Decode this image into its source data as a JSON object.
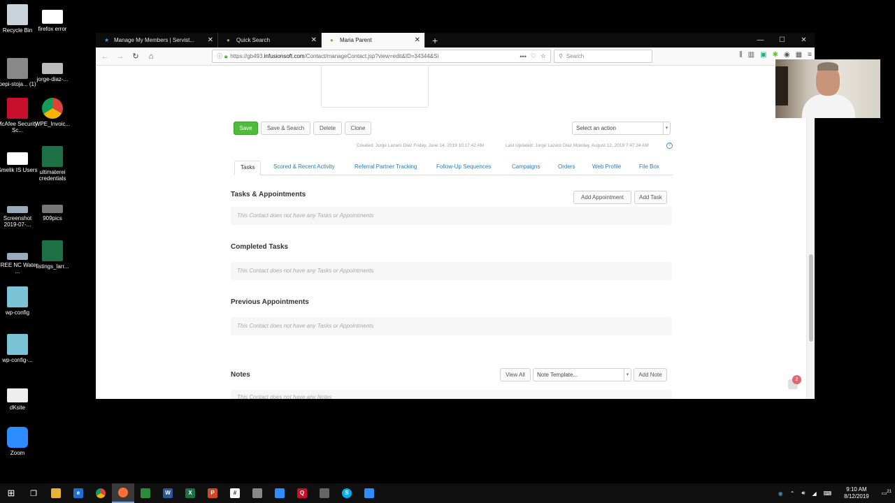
{
  "desktop": {
    "icons": [
      {
        "label": "Recycle Bin"
      },
      {
        "label": "firefox error"
      },
      {
        "label": "pepi-stoja... (1)"
      },
      {
        "label": "jorge-diaz-..."
      },
      {
        "label": "McAfee Security Sc..."
      },
      {
        "label": "WPE_Invoic..."
      },
      {
        "label": "Smelik IS Users"
      },
      {
        "label": "ultimaterei credentials"
      },
      {
        "label": "Screenshot 2019-07-..."
      },
      {
        "label": "909pics"
      },
      {
        "label": "FREE NC Water ..."
      },
      {
        "label": "listings_larr..."
      },
      {
        "label": "wp-config"
      },
      {
        "label": "wp-config-..."
      },
      {
        "label": "dKsite"
      },
      {
        "label": "Zoom"
      }
    ]
  },
  "browser": {
    "tabs": [
      {
        "title": "Manage My Members | Servist...",
        "active": false
      },
      {
        "title": "Quick Search",
        "active": false
      },
      {
        "title": "Maria Parent",
        "active": true
      }
    ],
    "new_tab": "+",
    "url_prefix": "https://gb493.",
    "url_domain": "infusionsoft.com",
    "url_path": "/Contact/manageContact.jsp?view=edit&ID=34344&Si",
    "search_placeholder": "Search",
    "url_actions": "•••"
  },
  "contact": {
    "buttons": {
      "save": "Save",
      "save_search": "Save & Search",
      "delete": "Delete",
      "clone": "Clone"
    },
    "action_select": "Select an action",
    "created_label": "Created:",
    "created_value": "Jorge Lazaro Diaz Friday, June 14, 2019 10:17:42 AM",
    "updated_label": "Last Updated:",
    "updated_value": "Jorge Lazaro Diaz Monday, August 12, 2019 7:47:34 AM",
    "tabs": [
      {
        "label": "Tasks"
      },
      {
        "label": "Scored & Recent Activity"
      },
      {
        "label": "Referral Partner Tracking"
      },
      {
        "label": "Follow-Up Sequences"
      },
      {
        "label": "Campaigns"
      },
      {
        "label": "Orders"
      },
      {
        "label": "Web Profile"
      },
      {
        "label": "File Box"
      }
    ],
    "sections": {
      "tasks_title": "Tasks & Appointments",
      "add_appointment": "Add Appointment",
      "add_task": "Add Task",
      "tasks_empty": "This Contact does not have any Tasks or Appointments",
      "completed_title": "Completed Tasks",
      "completed_empty": "This Contact does not have any Tasks or Appointments",
      "previous_title": "Previous Appointments",
      "previous_empty": "This Contact does not have any Tasks or Appointments",
      "notes_title": "Notes",
      "view_all": "View All",
      "note_template": "Note Template...",
      "add_note": "Add Note",
      "notes_empty": "This Contact does not have any Notes"
    },
    "chat_badge": "2"
  },
  "taskbar": {
    "time": "9:10 AM",
    "date": "8/12/2019",
    "notif_count": "21"
  }
}
